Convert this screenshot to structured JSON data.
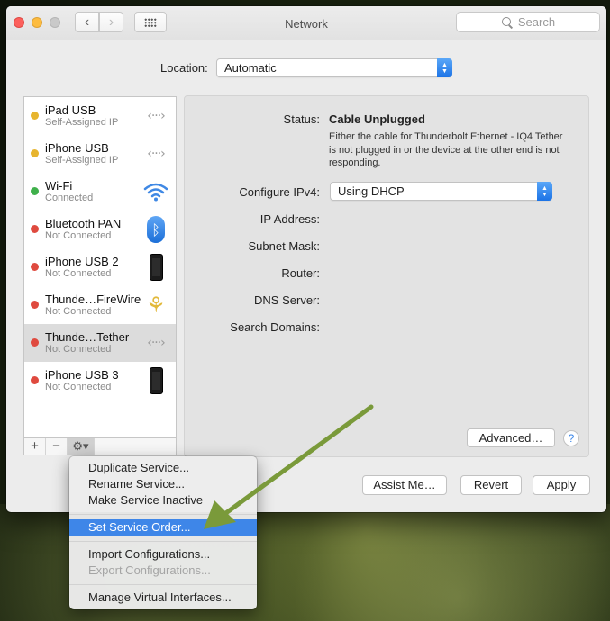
{
  "window": {
    "title": "Network",
    "search_placeholder": "Search"
  },
  "nav": {
    "back_icon": "chevron-left",
    "forward_icon": "chevron-right",
    "grid_icon": "grid-dots"
  },
  "location": {
    "label": "Location:",
    "value": "Automatic"
  },
  "services": [
    {
      "name": "iPad USB",
      "status": "Self-Assigned IP",
      "dot": "#e7b52f",
      "icon": "ethernet-arrows-icon"
    },
    {
      "name": "iPhone USB",
      "status": "Self-Assigned IP",
      "dot": "#e7b52f",
      "icon": "ethernet-arrows-icon"
    },
    {
      "name": "Wi-Fi",
      "status": "Connected",
      "dot": "#3fb04b",
      "icon": "wifi-icon"
    },
    {
      "name": "Bluetooth PAN",
      "status": "Not Connected",
      "dot": "#df4a3f",
      "icon": "bluetooth-icon"
    },
    {
      "name": "iPhone USB 2",
      "status": "Not Connected",
      "dot": "#df4a3f",
      "icon": "iphone-icon"
    },
    {
      "name": "Thunde…FireWire",
      "status": "Not Connected",
      "dot": "#df4a3f",
      "icon": "firewire-icon"
    },
    {
      "name": "Thunde…Tether",
      "status": "Not Connected",
      "dot": "#df4a3f",
      "icon": "ethernet-arrows-icon",
      "selected": true
    },
    {
      "name": "iPhone USB 3",
      "status": "Not Connected",
      "dot": "#df4a3f",
      "icon": "iphone-icon"
    }
  ],
  "sidebar_footer": {
    "add": "+",
    "remove": "−",
    "gear": "⚙▾"
  },
  "detail": {
    "status_label": "Status:",
    "status_value": "Cable Unplugged",
    "status_description": "Either the cable for Thunderbolt Ethernet - IQ4 Tether is not plugged in or the device at the other end is not responding.",
    "configure_label": "Configure IPv4:",
    "configure_value": "Using DHCP",
    "ip_label": "IP Address:",
    "subnet_label": "Subnet Mask:",
    "router_label": "Router:",
    "dns_label": "DNS Server:",
    "search_domains_label": "Search Domains:",
    "advanced_button": "Advanced…",
    "help_button": "?"
  },
  "buttons": {
    "assist": "Assist Me…",
    "revert": "Revert",
    "apply": "Apply"
  },
  "menu": {
    "items": [
      {
        "label": "Duplicate Service...",
        "state": "normal"
      },
      {
        "label": "Rename Service...",
        "state": "normal"
      },
      {
        "label": "Make Service Inactive",
        "state": "normal"
      },
      {
        "label": "Set Service Order...",
        "state": "highlighted"
      },
      {
        "label": "Import Configurations...",
        "state": "normal"
      },
      {
        "label": "Export Configurations...",
        "state": "disabled"
      },
      {
        "label": "Manage Virtual Interfaces...",
        "state": "normal"
      }
    ]
  },
  "colors": {
    "accent": "#3e86e8",
    "annotation_arrow": "#7a9a3a"
  }
}
